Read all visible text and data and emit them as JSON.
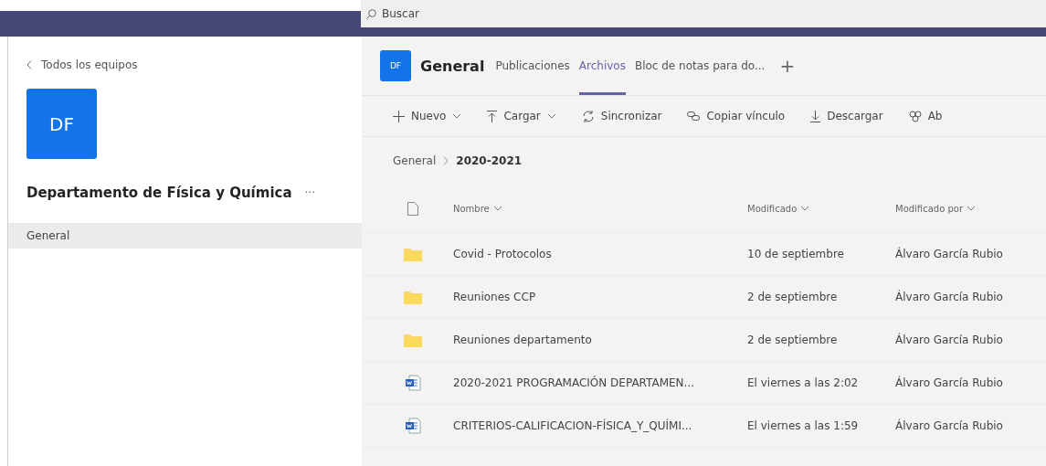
{
  "search": {
    "placeholder": "Buscar"
  },
  "sidebar": {
    "back_link": "Todos los equipos",
    "team_avatar": "DF",
    "team_name": "Departamento de Física y Química",
    "more": "···",
    "channels": [
      {
        "label": "General",
        "selected": true
      }
    ]
  },
  "channel_header": {
    "avatar": "DF",
    "title": "General",
    "tabs": [
      {
        "label": "Publicaciones",
        "selected": false
      },
      {
        "label": "Archivos",
        "selected": true
      },
      {
        "label": "Bloc de notas para do...",
        "selected": false
      }
    ],
    "add_tab": "+"
  },
  "toolbar": [
    {
      "kind": "new",
      "label": "Nuevo",
      "dropdown": true
    },
    {
      "kind": "upload",
      "label": "Cargar",
      "dropdown": true
    },
    {
      "kind": "sync",
      "label": "Sincronizar",
      "dropdown": false
    },
    {
      "kind": "link",
      "label": "Copiar vínculo",
      "dropdown": false
    },
    {
      "kind": "download",
      "label": "Descargar",
      "dropdown": false
    },
    {
      "kind": "open",
      "label": "Ab",
      "dropdown": false
    }
  ],
  "breadcrumb": [
    {
      "label": "General",
      "selected": false
    },
    {
      "label": "2020-2021",
      "selected": true
    }
  ],
  "table": {
    "columns": [
      "Nombre",
      "Modificado",
      "Modificado por"
    ],
    "rows": [
      {
        "kind": "folder",
        "name": "Covid - Protocolos",
        "modified": "10 de septiembre",
        "modified_by": "Álvaro García Rubio"
      },
      {
        "kind": "folder",
        "name": "Reuniones CCP",
        "modified": "2 de septiembre",
        "modified_by": "Álvaro García Rubio"
      },
      {
        "kind": "folder",
        "name": "Reuniones departamento",
        "modified": "2 de septiembre",
        "modified_by": "Álvaro García Rubio"
      },
      {
        "kind": "word",
        "name": "2020-2021 PROGRAMACIÓN DEPARTAMEN...",
        "modified": "El viernes a las 2:02",
        "modified_by": "Álvaro García Rubio"
      },
      {
        "kind": "word",
        "name": "CRITERIOS-CALIFICACION-FÍSICA_Y_QUÍMI...",
        "modified": "El viernes a las 1:59",
        "modified_by": "Álvaro García Rubio"
      }
    ]
  }
}
